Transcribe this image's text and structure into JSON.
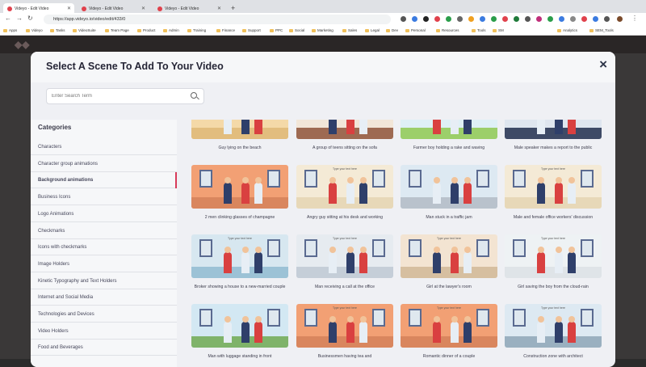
{
  "browser": {
    "tabs": [
      {
        "label": "Videyo - Edit Video",
        "active": true
      },
      {
        "label": "Videyo - Edit Video",
        "active": false
      },
      {
        "label": "Videyo - Edit Video",
        "active": false
      }
    ],
    "url": "https://app.videyo.io/video/edit/433/0",
    "bookmarks": [
      "Apps",
      "Videyo",
      "Tasks",
      "VideoSuite",
      "Team Page",
      "Product",
      "Admin",
      "Training",
      "Finance",
      "Support",
      "PPC",
      "Social",
      "Marketing",
      "Sales",
      "Legal",
      "Dev",
      "Personal",
      "Resources",
      "Tools",
      "SM",
      "Analytics",
      "SEM_Tools"
    ]
  },
  "modal": {
    "title": "Select A Scene To Add To Your Video",
    "close_icon": "×",
    "search_placeholder": "Enter Search Term"
  },
  "sidebar": {
    "title": "Categories",
    "items": [
      {
        "label": "Characters",
        "active": false
      },
      {
        "label": "Character group animations",
        "active": false
      },
      {
        "label": "Background animations",
        "active": true
      },
      {
        "label": "Business Icons",
        "active": false
      },
      {
        "label": "Logo Animations",
        "active": false
      },
      {
        "label": "Checkmarks",
        "active": false
      },
      {
        "label": "Icons with checkmarks",
        "active": false
      },
      {
        "label": "Image Holders",
        "active": false
      },
      {
        "label": "Kinetic Typography and Text Holders",
        "active": false
      },
      {
        "label": "Internet and Social Media",
        "active": false
      },
      {
        "label": "Technologies and Devices",
        "active": false
      },
      {
        "label": "Video Holders",
        "active": false
      },
      {
        "label": "Food and Beverages",
        "active": false
      }
    ]
  },
  "scenes": [
    {
      "label": "Guy lying on the beach",
      "caption": "",
      "bg": "#f4d9a8",
      "floor": "#e2bd7e"
    },
    {
      "label": "A group of teens sitting on the sofa",
      "caption": "",
      "bg": "#f2e6d8",
      "floor": "#9e6a52"
    },
    {
      "label": "Farmer boy holding a rake and waving",
      "caption": "",
      "bg": "#dff0f6",
      "floor": "#9ccf6a"
    },
    {
      "label": "Male speaker makes a report to the public",
      "caption": "",
      "bg": "#dfe6ef",
      "floor": "#3e4a66"
    },
    {
      "label": "2 men clinking glasses of champagne",
      "caption": "",
      "bg": "#f2a074",
      "floor": "#d9865e"
    },
    {
      "label": "Angry guy sitting at his desk and working",
      "caption": "Type your text here",
      "bg": "#f4ead6",
      "floor": "#e7d8b8"
    },
    {
      "label": "Man stuck in a traffic jam",
      "caption": "",
      "bg": "#dde9f2",
      "floor": "#b9c2cc"
    },
    {
      "label": "Male and female office workers' discussion",
      "caption": "Type your text here",
      "bg": "#f4ead6",
      "floor": "#e7d8b8"
    },
    {
      "label": "Broker showing a house to a new-married couple",
      "caption": "Type your text here",
      "bg": "#d7e7f0",
      "floor": "#9cc2d6"
    },
    {
      "label": "Man receiving a call at the office",
      "caption": "Type your text here",
      "bg": "#e6ebf0",
      "floor": "#c5ced8"
    },
    {
      "label": "Girl at the lawyer's room",
      "caption": "Type your text here",
      "bg": "#f3e4d2",
      "floor": "#d6bfa0"
    },
    {
      "label": "Girl saving the boy from the cloud-rain",
      "caption": "Type your text here",
      "bg": "#eef2f4",
      "floor": "#dfe4e8"
    },
    {
      "label": "Man with luggage standing in front",
      "caption": "",
      "bg": "#d3e8f3",
      "floor": "#7fb36a"
    },
    {
      "label": "Businessmen having tea and",
      "caption": "Type your text here",
      "bg": "#f2a074",
      "floor": "#d9865e"
    },
    {
      "label": "Romantic dinner of a couple",
      "caption": "Type your text here",
      "bg": "#f2a074",
      "floor": "#d9865e"
    },
    {
      "label": "Construction zone with architect",
      "caption": "Type your text here",
      "bg": "#dde9f2",
      "floor": "#9ab0c0"
    }
  ]
}
